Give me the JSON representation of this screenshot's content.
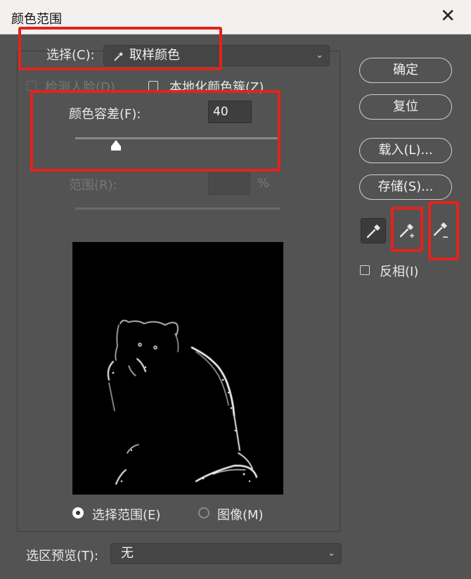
{
  "window": {
    "title": "颜色范围",
    "close_glyph": "✕"
  },
  "select": {
    "label": "选择(C):",
    "value": "取样颜色"
  },
  "detect_faces": {
    "label": "检测人脸(D)"
  },
  "localized_clusters": {
    "label": "本地化颜色簇(Z)"
  },
  "fuzziness": {
    "label": "颜色容差(F):",
    "value": "40",
    "fraction": 0.2
  },
  "range": {
    "label": "范围(R):",
    "value": "",
    "unit": "%"
  },
  "preview_mode": {
    "selection_label": "选择范围(E)",
    "image_label": "图像(M)",
    "selected": "selection"
  },
  "selection_preview": {
    "label": "选区预览(T):",
    "value": "无"
  },
  "buttons": {
    "ok": "确定",
    "reset": "复位",
    "load": "载入(L)...",
    "save": "存储(S)..."
  },
  "tools": [
    "eyedropper-icon",
    "eyedropper-plus-icon",
    "eyedropper-minus-icon"
  ],
  "invert": {
    "label": "反相(I)",
    "checked": false
  },
  "colors": {
    "dialog_bg": "#535353",
    "highlight": "#e3231b",
    "titlebar": "#f3f0f0"
  }
}
